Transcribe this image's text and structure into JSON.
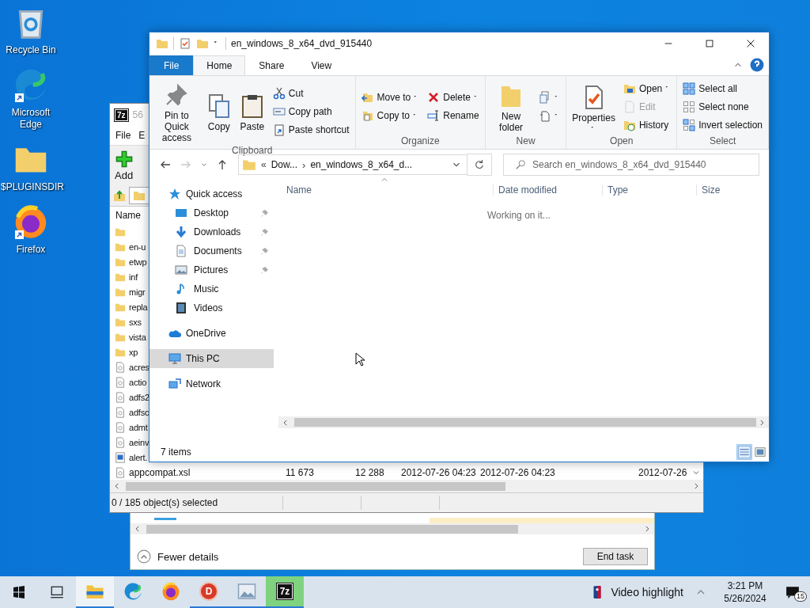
{
  "desktop_icons": [
    {
      "kind": "recycle",
      "label": "Recycle Bin",
      "shortcut": false
    },
    {
      "kind": "edge",
      "label": "Microsoft Edge",
      "shortcut": true
    },
    {
      "kind": "folder",
      "label": "$PLUGINSDIR",
      "shortcut": false
    },
    {
      "kind": "firefox",
      "label": "Firefox",
      "shortcut": true
    }
  ],
  "task_manager": {
    "fewer_details": "Fewer details",
    "end_task": "End task"
  },
  "sevenzip": {
    "logo": "7z",
    "title": "56",
    "menu": [
      "File",
      "E"
    ],
    "toolbar": [
      {
        "kind": "add",
        "label": "Add"
      }
    ],
    "name_column": "Name",
    "rows": [
      {
        "kind": "folder"
      },
      {
        "kind": "folder",
        "name": "en-u"
      },
      {
        "kind": "folder",
        "name": "etwp"
      },
      {
        "kind": "folder",
        "name": "inf"
      },
      {
        "kind": "folder",
        "name": "migr"
      },
      {
        "kind": "folder",
        "name": "repla"
      },
      {
        "kind": "folder",
        "name": "sxs"
      },
      {
        "kind": "folder",
        "name": "vista"
      },
      {
        "kind": "folder",
        "name": "xp"
      },
      {
        "kind": "file",
        "name": "acres"
      },
      {
        "kind": "file",
        "name": "actio"
      },
      {
        "kind": "file",
        "name": "adfs2"
      },
      {
        "kind": "file",
        "name": "adfsc"
      },
      {
        "kind": "file",
        "name": "admt"
      },
      {
        "kind": "file",
        "name": "aeinv"
      },
      {
        "kind": "html",
        "name": "alert."
      }
    ],
    "last_row": {
      "kind": "file",
      "name": "appcompat.xsl",
      "cells": [
        "11 673",
        "12 288",
        "2012-07-26 04:23",
        "2012-07-26 04:23",
        "2012-07-26"
      ]
    },
    "status": "0 / 185 object(s) selected"
  },
  "explorer": {
    "title": "en_windows_8_x64_dvd_915440",
    "tabs": [
      {
        "label": "File",
        "kind": "file",
        "selected": false
      },
      {
        "label": "Home",
        "kind": "tab",
        "selected": true
      },
      {
        "label": "Share",
        "kind": "tab",
        "selected": false
      },
      {
        "label": "View",
        "kind": "tab",
        "selected": false
      }
    ],
    "ribbon": [
      {
        "name": "Clipboard",
        "columns": [
          [
            {
              "kind": "pin",
              "label": "Pin to Quick access",
              "dropdown": false,
              "disabled": false
            }
          ],
          [
            {
              "kind": "copy",
              "label": "Copy",
              "dropdown": false,
              "disabled": false
            }
          ],
          [
            {
              "kind": "paste",
              "label": "Paste",
              "dropdown": false,
              "disabled": false
            }
          ],
          [
            {
              "kind": "cut",
              "label": "Cut",
              "dropdown": false,
              "disabled": false
            },
            {
              "kind": "copypath",
              "label": "Copy path",
              "dropdown": false,
              "disabled": false
            },
            {
              "kind": "shortcut",
              "label": "Paste shortcut",
              "dropdown": false,
              "disabled": false
            }
          ]
        ]
      },
      {
        "name": "Organize",
        "columns": [
          [
            {
              "kind": "moveto",
              "label": "Move to",
              "dropdown": true,
              "disabled": false
            },
            {
              "kind": "copyto",
              "label": "Copy to",
              "dropdown": true,
              "disabled": false
            }
          ],
          [
            {
              "kind": "delete",
              "label": "Delete",
              "dropdown": true,
              "disabled": false
            },
            {
              "kind": "rename",
              "label": "Rename",
              "dropdown": false,
              "disabled": false
            }
          ]
        ]
      },
      {
        "name": "New",
        "columns": [
          [
            {
              "kind": "newfolder",
              "label": "New folder",
              "dropdown": false,
              "disabled": false
            }
          ],
          [
            {
              "kind": "newitem",
              "dropdown": true,
              "disabled": false
            },
            {
              "kind": "easyaccess",
              "dropdown": true,
              "disabled": false
            }
          ]
        ]
      },
      {
        "name": "Open",
        "columns": [
          [
            {
              "kind": "properties",
              "label": "Properties",
              "dropdown": true,
              "disabled": false
            }
          ],
          [
            {
              "kind": "open",
              "label": "Open",
              "dropdown": true,
              "disabled": false
            },
            {
              "kind": "edit",
              "label": "Edit",
              "dropdown": false,
              "disabled": true
            },
            {
              "kind": "history",
              "label": "History",
              "dropdown": false,
              "disabled": false
            }
          ]
        ]
      },
      {
        "name": "Select",
        "columns": [
          [
            {
              "kind": "selectall",
              "label": "Select all",
              "dropdown": false,
              "disabled": false
            },
            {
              "kind": "selectnone",
              "label": "Select none",
              "dropdown": false,
              "disabled": false
            },
            {
              "kind": "invert",
              "label": "Invert selection",
              "dropdown": false,
              "disabled": false
            }
          ]
        ]
      }
    ],
    "address": {
      "overflow": "«",
      "separator": "›",
      "crumbs": [
        "Dow...",
        "en_windows_8_x64_d..."
      ]
    },
    "search": {
      "placeholder": "Search en_windows_8_x64_dvd_915440"
    },
    "nav": [
      {
        "kind": "star",
        "label": "Quick access",
        "selected": false,
        "children": [
          {
            "kind": "desktop",
            "label": "Desktop",
            "pinned": true,
            "selected": false
          },
          {
            "kind": "downloads",
            "label": "Downloads",
            "pinned": true,
            "selected": false
          },
          {
            "kind": "documents",
            "label": "Documents",
            "pinned": true,
            "selected": false
          },
          {
            "kind": "pictures",
            "label": "Pictures",
            "pinned": true,
            "selected": false
          },
          {
            "kind": "music",
            "label": "Music",
            "pinned": false,
            "selected": false
          },
          {
            "kind": "videos",
            "label": "Videos",
            "pinned": false,
            "selected": false
          }
        ]
      },
      {
        "kind": "onedrive",
        "label": "OneDrive",
        "selected": false
      },
      {
        "kind": "pc",
        "label": "This PC",
        "selected": true
      },
      {
        "kind": "network",
        "label": "Network",
        "selected": false
      }
    ],
    "columns": [
      "Name",
      "Date modified",
      "Type",
      "Size"
    ],
    "message": "Working on it...",
    "status": "7 items"
  },
  "taskbar": {
    "apps": [
      {
        "kind": "explorer",
        "running": true,
        "selected": true,
        "progress": false
      },
      {
        "kind": "edge",
        "running": false,
        "selected": false,
        "progress": false
      },
      {
        "kind": "firefox",
        "running": false,
        "selected": false,
        "progress": false
      },
      {
        "kind": "dapp",
        "text": "D",
        "running": true,
        "selected": false,
        "progress": false
      },
      {
        "kind": "photos",
        "running": true,
        "selected": false,
        "progress": false
      },
      {
        "kind": "sevenzip",
        "text": "7z",
        "running": true,
        "selected": false,
        "progress": true
      }
    ],
    "widget": "Video highlight",
    "time": "3:21 PM",
    "date": "5/26/2024",
    "notifications": "15"
  }
}
